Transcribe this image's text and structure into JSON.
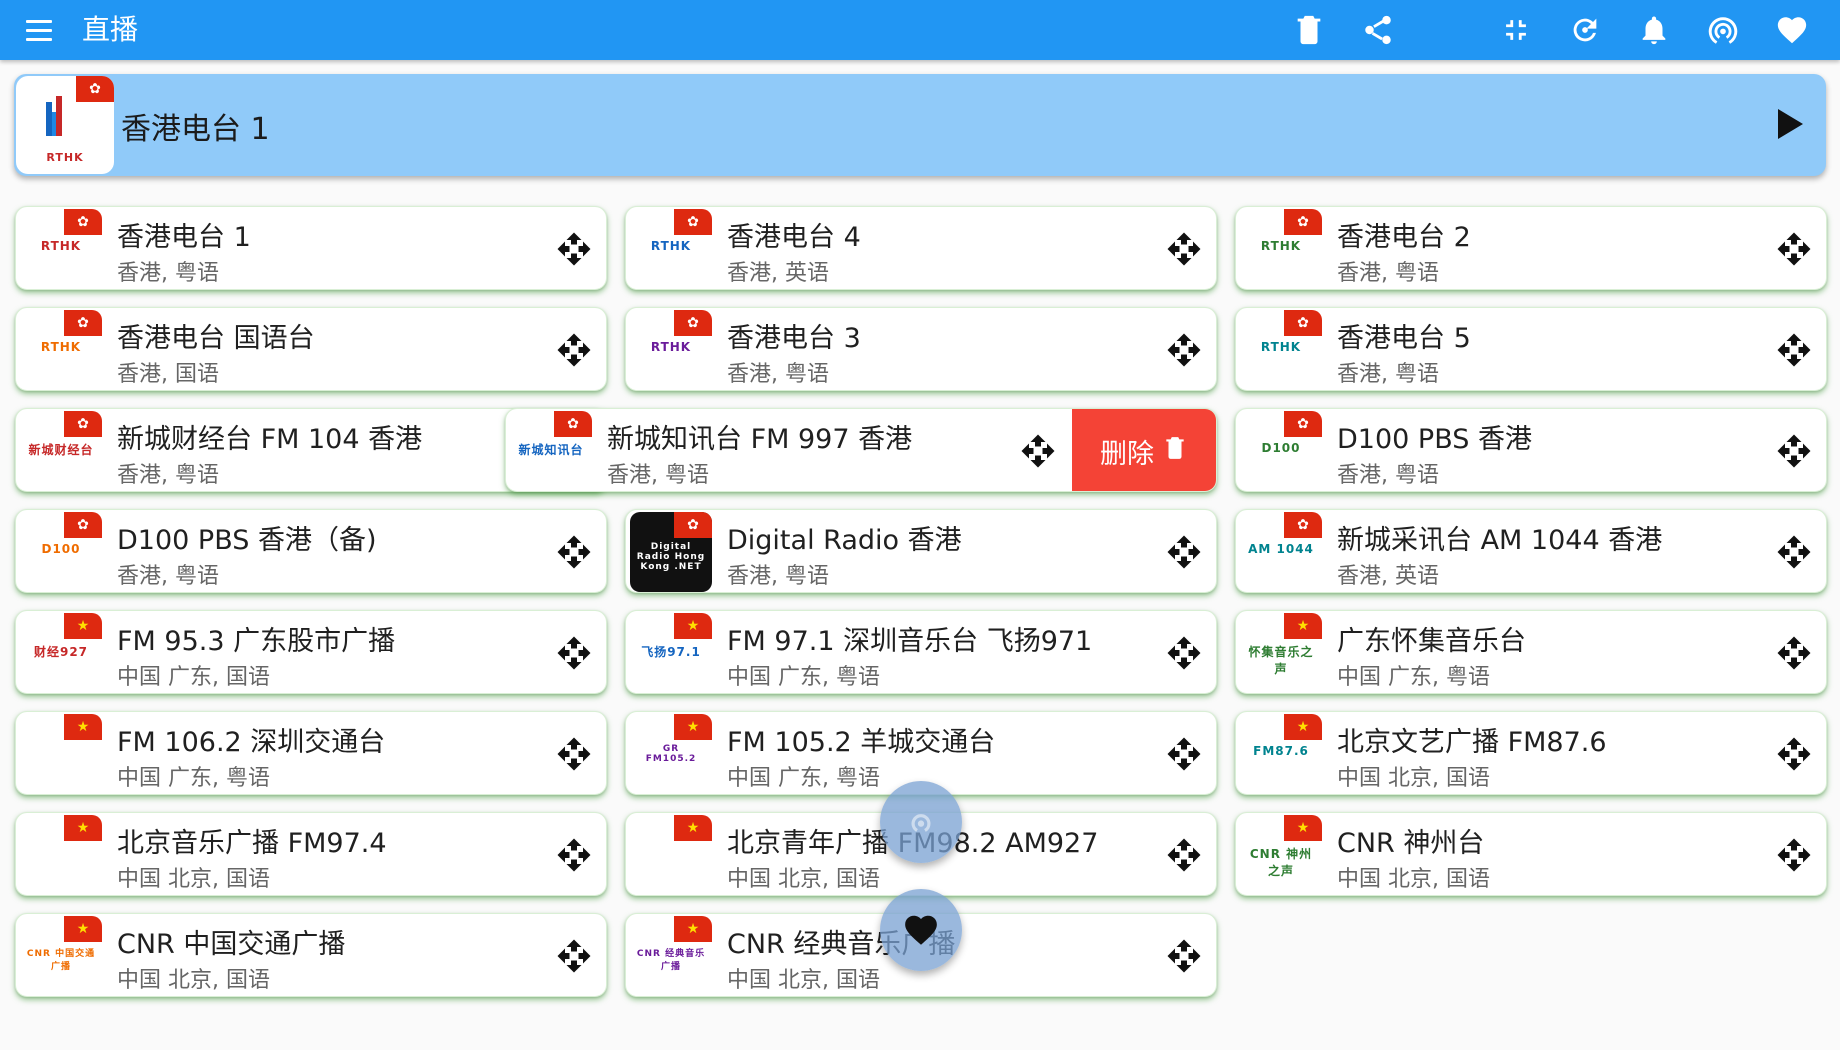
{
  "header": {
    "title": "直播"
  },
  "now_playing": {
    "name": "香港电台 1",
    "logo_text": "RTHK"
  },
  "delete_label": "删除",
  "stations": [
    {
      "name": "香港电台 1",
      "meta": "香港, 粤语",
      "logo": "RTHK",
      "flag": "hk"
    },
    {
      "name": "香港电台 4",
      "meta": "香港, 英语",
      "logo": "RTHK",
      "flag": "hk"
    },
    {
      "name": "香港电台 2",
      "meta": "香港, 粤语",
      "logo": "RTHK",
      "flag": "hk"
    },
    {
      "name": "香港电台 国语台",
      "meta": "香港, 国语",
      "logo": "RTHK",
      "flag": "hk"
    },
    {
      "name": "香港电台 3",
      "meta": "香港, 粤语",
      "logo": "RTHK",
      "flag": "hk"
    },
    {
      "name": "香港电台 5",
      "meta": "香港, 粤语",
      "logo": "RTHK",
      "flag": "hk"
    },
    {
      "name": "新城财经台 FM 104 香港",
      "meta": "香港, 粤语",
      "logo": "新城财经台",
      "flag": "hk"
    },
    {
      "name": "新城知讯台 FM 997 香港",
      "meta": "香港, 粤语",
      "logo": "新城知讯台",
      "flag": "hk"
    },
    {
      "name": "D100 PBS 香港",
      "meta": "香港, 粤语",
      "logo": "D100",
      "flag": "hk"
    },
    {
      "name": "D100 PBS 香港（备)",
      "meta": "香港, 粤语",
      "logo": "D100",
      "flag": "hk"
    },
    {
      "name": "Digital Radio 香港",
      "meta": "香港, 粤语",
      "logo": "Digital Radio Hong Kong .NET",
      "flag": "hk"
    },
    {
      "name": "新城采讯台 AM 1044 香港",
      "meta": "香港, 英语",
      "logo": "AM 1044",
      "flag": "hk"
    },
    {
      "name": "FM 95.3 广东股市广播",
      "meta": "中国 广东, 国语",
      "logo": "财经927",
      "flag": "cn"
    },
    {
      "name": "FM 97.1 深圳音乐台 飞扬971",
      "meta": "中国 广东, 粤语",
      "logo": "飞扬97.1",
      "flag": "cn"
    },
    {
      "name": "广东怀集音乐台",
      "meta": "中国 广东, 粤语",
      "logo": "怀集音乐之声",
      "flag": "cn"
    },
    {
      "name": "FM 106.2 深圳交通台",
      "meta": "中国 广东, 粤语",
      "logo": "",
      "flag": "cn"
    },
    {
      "name": "FM 105.2 羊城交通台",
      "meta": "中国 广东, 粤语",
      "logo": "GR FM105.2",
      "flag": "cn"
    },
    {
      "name": "北京文艺广播 FM87.6",
      "meta": "中国 北京, 国语",
      "logo": "FM87.6",
      "flag": "cn"
    },
    {
      "name": "北京音乐广播 FM97.4",
      "meta": "中国 北京, 国语",
      "logo": "",
      "flag": "cn"
    },
    {
      "name": "北京青年广播 FM98.2 AM927",
      "meta": "中国 北京, 国语",
      "logo": "",
      "flag": "cn"
    },
    {
      "name": "CNR 神州台",
      "meta": "中国 北京, 国语",
      "logo": "CNR 神州之声",
      "flag": "cn"
    },
    {
      "name": "CNR 中国交通广播",
      "meta": "中国 北京, 国语",
      "logo": "CNR 中国交通广播",
      "flag": "cn"
    },
    {
      "name": "CNR 经典音乐广播",
      "meta": "中国 北京, 国语",
      "logo": "CNR 经典音乐广播",
      "flag": "cn"
    }
  ]
}
